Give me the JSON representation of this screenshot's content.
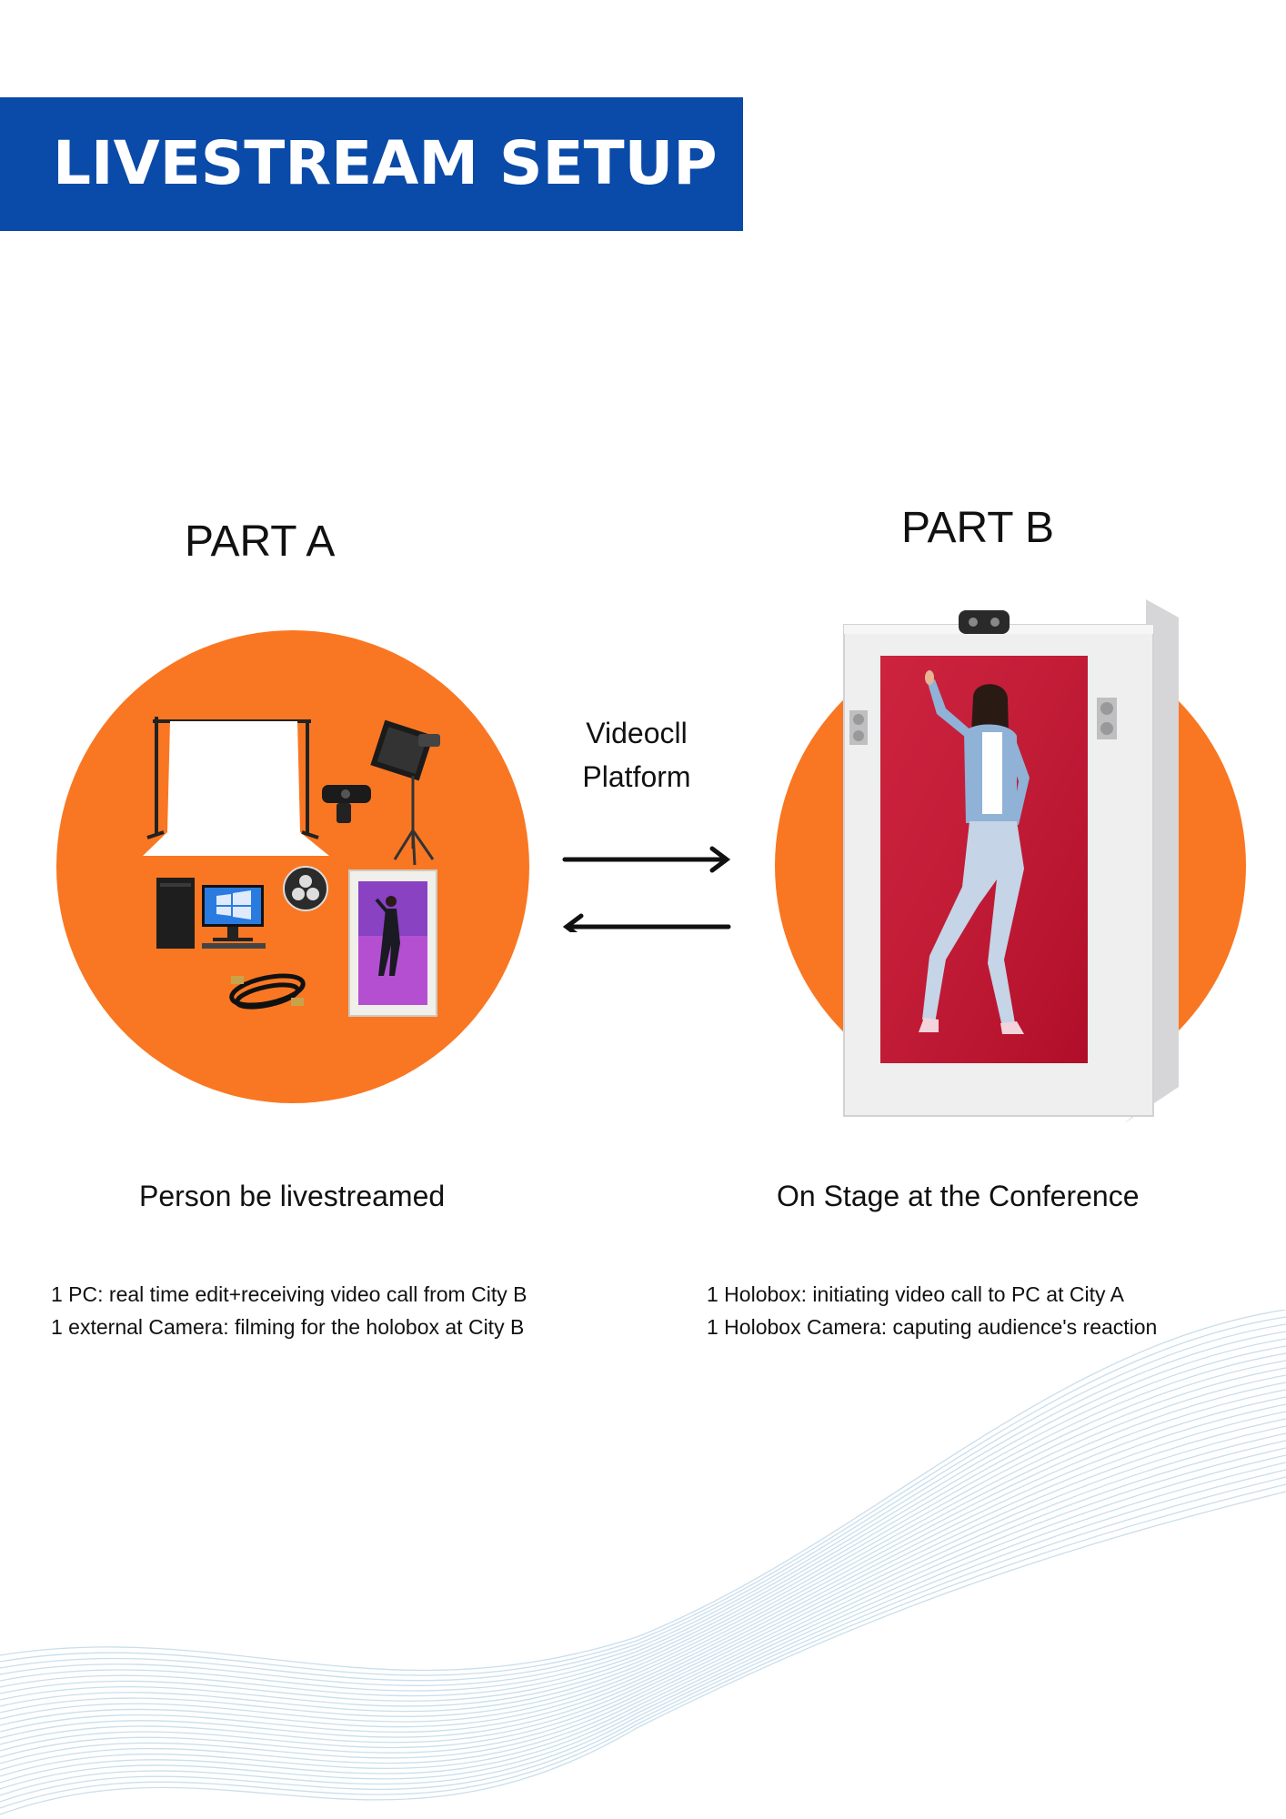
{
  "header": {
    "title": "LIVESTREAM SETUP"
  },
  "part_a": {
    "title": "PART A",
    "caption": "Person be livestreamed",
    "notes": [
      "1 PC: real time edit+receiving video call from City B",
      "1 external Camera: filming for the holobox at City B"
    ]
  },
  "part_b": {
    "title": "PART B",
    "caption": "On Stage at the Conference",
    "notes": [
      "1 Holobox: initiating video call to PC at City A",
      "1 Holobox Camera: caputing audience's reaction"
    ]
  },
  "middle": {
    "line1": "Videocll",
    "line2": "Platform"
  },
  "colors": {
    "banner": "#0a4aa8",
    "accent_orange": "#f97722",
    "holobox_red": "#c8102e",
    "wave_lines": "#b7d3e6"
  }
}
